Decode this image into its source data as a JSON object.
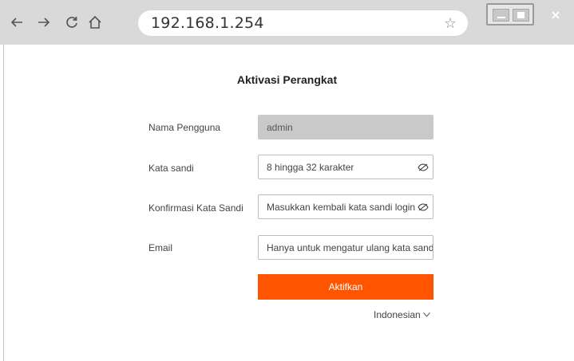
{
  "browser": {
    "address": "192.168.1.254",
    "close_glyph": "×"
  },
  "page": {
    "title": "Aktivasi Perangkat",
    "fields": {
      "username": {
        "label": "Nama Pengguna",
        "value": "admin"
      },
      "password": {
        "label": "Kata sandi",
        "placeholder": "8 hingga 32 karakter"
      },
      "confirm": {
        "label": "Konfirmasi Kata Sandi",
        "placeholder": "Masukkan kembali kata sandi login"
      },
      "email": {
        "label": "Email",
        "placeholder": "Hanya untuk mengatur ulang kata sandi"
      }
    },
    "activate_label": "Aktifkan",
    "language": "Indonesian"
  },
  "colors": {
    "accent": "#ff5500",
    "chrome": "#d9d9d9",
    "readonly_field": "#c9c9c9"
  },
  "icons": [
    "back-arrow-icon",
    "forward-arrow-icon",
    "reload-icon",
    "home-icon",
    "star-icon",
    "eye-hidden-icon",
    "chevron-down-icon"
  ]
}
